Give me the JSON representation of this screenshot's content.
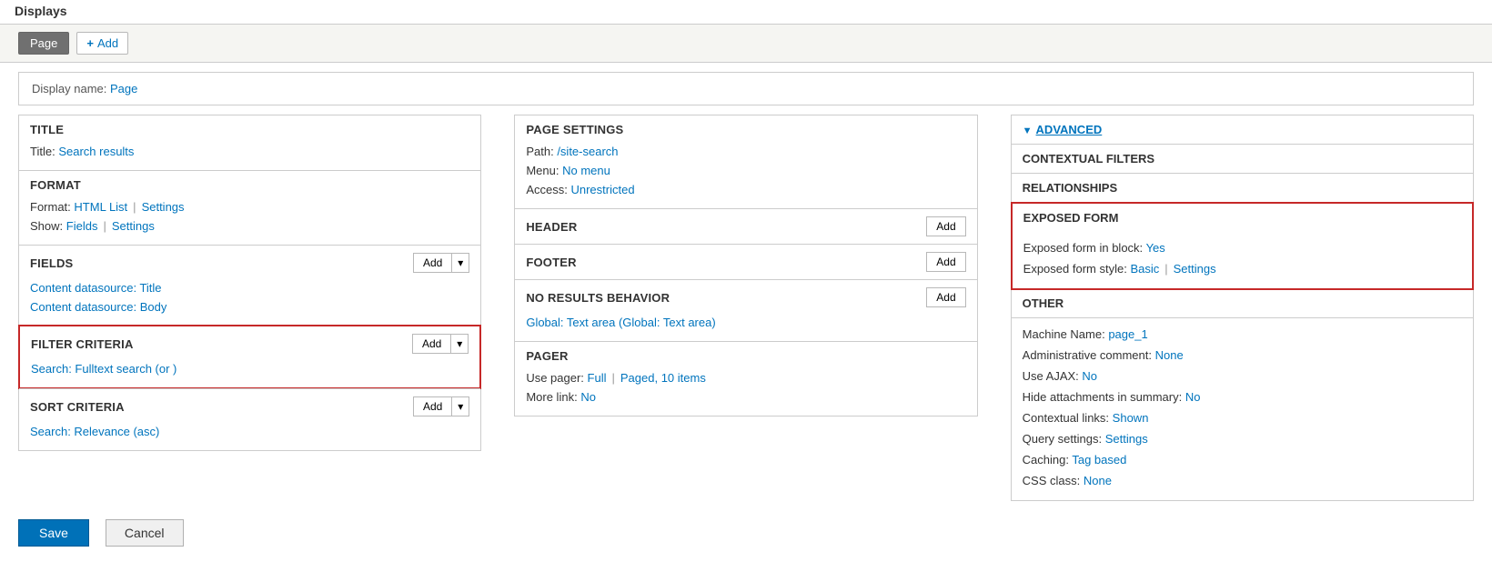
{
  "header": "Displays",
  "tabs": {
    "active": "Page",
    "add": "Add"
  },
  "display_name": {
    "label": "Display name:",
    "value": "Page"
  },
  "left": {
    "title": {
      "head": "TITLE",
      "items": [
        {
          "label": "Title:",
          "link": "Search results"
        }
      ]
    },
    "format": {
      "head": "FORMAT",
      "items": [
        {
          "label": "Format:",
          "link": "HTML List",
          "link2": "Settings"
        },
        {
          "label": "Show:",
          "link": "Fields",
          "link2": "Settings"
        }
      ]
    },
    "fields": {
      "head": "FIELDS",
      "add": "Add",
      "items": [
        {
          "link": "Content datasource: Title"
        },
        {
          "link": "Content datasource: Body"
        }
      ]
    },
    "filter": {
      "head": "FILTER CRITERIA",
      "add": "Add",
      "items": [
        {
          "link": "Search: Fulltext search (or )"
        }
      ]
    },
    "sort": {
      "head": "SORT CRITERIA",
      "add": "Add",
      "items": [
        {
          "link": "Search: Relevance (asc)"
        }
      ]
    }
  },
  "mid": {
    "page_settings": {
      "head": "PAGE SETTINGS",
      "items": [
        {
          "label": "Path:",
          "link": "/site-search"
        },
        {
          "label": "Menu:",
          "link": "No menu"
        },
        {
          "label": "Access:",
          "link": "Unrestricted"
        }
      ]
    },
    "header": {
      "head": "HEADER",
      "add": "Add"
    },
    "footer": {
      "head": "FOOTER",
      "add": "Add"
    },
    "no_results": {
      "head": "NO RESULTS BEHAVIOR",
      "add": "Add",
      "items": [
        {
          "link": "Global: Text area (Global: Text area)"
        }
      ]
    },
    "pager": {
      "head": "PAGER",
      "items": [
        {
          "label": "Use pager:",
          "link": "Full",
          "link2": "Paged, 10 items"
        },
        {
          "label": "More link:",
          "link": "No"
        }
      ]
    }
  },
  "right": {
    "advanced": "ADVANCED",
    "contextual_filters": "CONTEXTUAL FILTERS",
    "relationships": "RELATIONSHIPS",
    "exposed": {
      "head": "EXPOSED FORM",
      "items": [
        {
          "label": "Exposed form in block:",
          "link": "Yes"
        },
        {
          "label": "Exposed form style:",
          "link": "Basic",
          "link2": "Settings"
        }
      ]
    },
    "other": {
      "head": "OTHER",
      "items": [
        {
          "label": "Machine Name:",
          "link": "page_1"
        },
        {
          "label": "Administrative comment:",
          "link": "None"
        },
        {
          "label": "Use AJAX:",
          "link": "No"
        },
        {
          "label": "Hide attachments in summary:",
          "link": "No"
        },
        {
          "label": "Contextual links:",
          "link": "Shown"
        },
        {
          "label": "Query settings:",
          "link": "Settings"
        },
        {
          "label": "Caching:",
          "link": "Tag based"
        },
        {
          "label": "CSS class:",
          "link": "None"
        }
      ]
    }
  },
  "footer_buttons": {
    "save": "Save",
    "cancel": "Cancel"
  }
}
